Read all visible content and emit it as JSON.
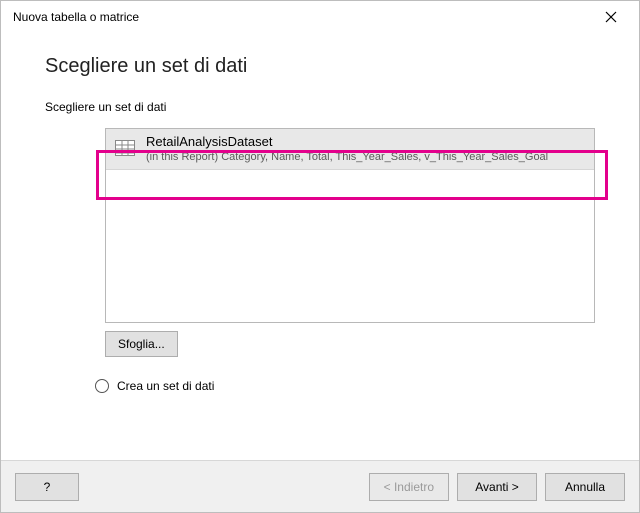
{
  "window": {
    "title": "Nuova tabella o matrice"
  },
  "page": {
    "heading": "Scegliere un set di dati",
    "subheading": "Scegliere un set di dati"
  },
  "dataset": {
    "name": "RetailAnalysisDataset",
    "detail": "(in this Report) Category, Name, Total, This_Year_Sales, v_This_Year_Sales_Goal"
  },
  "buttons": {
    "browse": "Sfoglia...",
    "help": "?",
    "back": "< Indietro",
    "next": "Avanti >",
    "cancel": "Annulla"
  },
  "options": {
    "create_dataset": "Crea un set di dati"
  }
}
